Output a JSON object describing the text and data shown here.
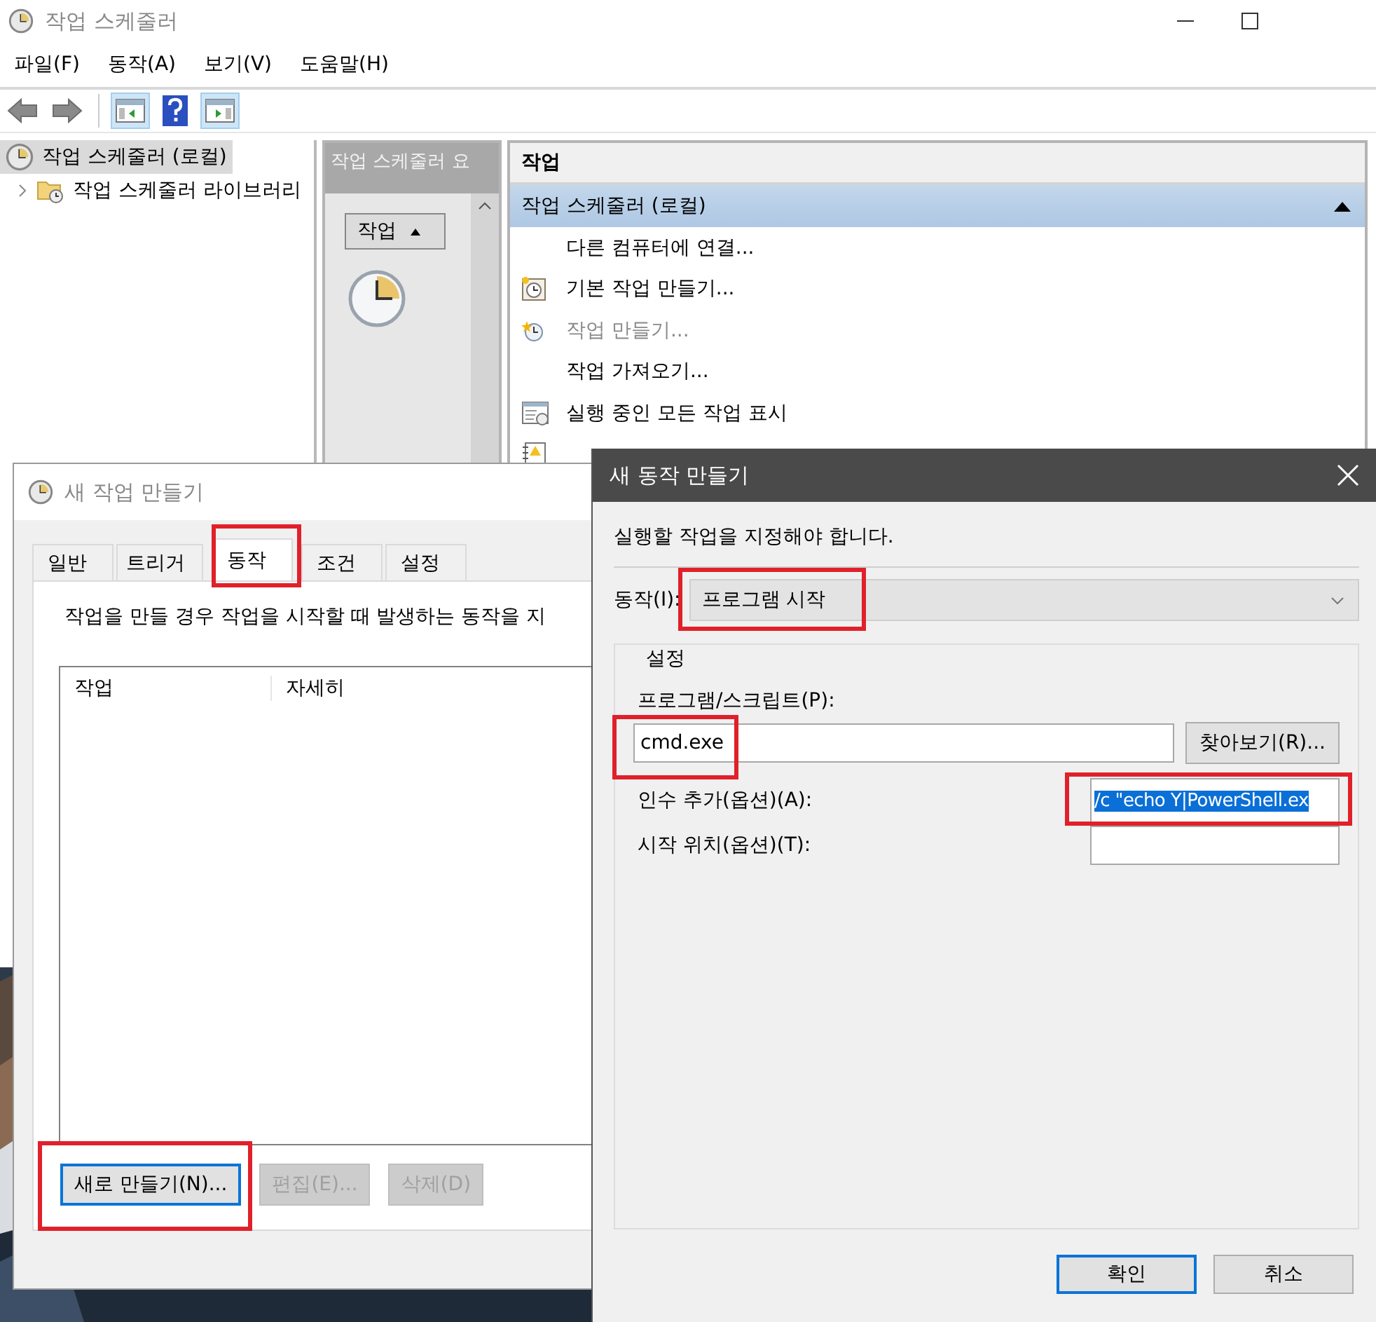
{
  "main_window": {
    "title": "작업 스케줄러"
  },
  "menu": [
    "파일(F)",
    "동작(A)",
    "보기(V)",
    "도움말(H)"
  ],
  "toolbar": [
    {
      "kind": "back",
      "on": false
    },
    {
      "kind": "forward",
      "on": false
    },
    {
      "kind": "panel-left",
      "on": true
    },
    {
      "kind": "help",
      "on": false
    },
    {
      "kind": "panel-right",
      "on": true
    }
  ],
  "tree": [
    {
      "label": "작업 스케줄러 (로컬)",
      "selected": true,
      "children": [
        {
          "label": "작업 스케줄러 라이브러리",
          "selected": false,
          "expanded": false
        }
      ]
    }
  ],
  "summary_pane": {
    "title": "작업 스케줄러 요",
    "column_header": "작업"
  },
  "actions_pane": {
    "title": "작업",
    "group": {
      "label": "작업 스케줄러 (로컬)",
      "expanded": true
    },
    "items": [
      {
        "label": "다른 컴퓨터에 연결...",
        "kind": "plain",
        "disabled": false
      },
      {
        "label": "기본 작업 만들기...",
        "kind": "calendar-clock",
        "disabled": false
      },
      {
        "label": "작업 만들기...",
        "kind": "clock-star",
        "disabled": true
      },
      {
        "label": "작업 가져오기...",
        "kind": "plain",
        "disabled": false
      },
      {
        "label": "실행 중인 모든 작업 표시",
        "kind": "window-list",
        "disabled": false
      },
      {
        "kind": "notebook"
      }
    ]
  },
  "create_task_dialog": {
    "title": "새 작업 만들기",
    "tabs": [
      {
        "label": "일반",
        "selected": false,
        "highlighted": false
      },
      {
        "label": "트리거",
        "selected": false,
        "highlighted": false
      },
      {
        "label": "동작",
        "selected": true,
        "highlighted": true
      },
      {
        "label": "조건",
        "selected": false,
        "highlighted": false
      },
      {
        "label": "설정",
        "selected": false,
        "highlighted": false
      }
    ],
    "description": "작업을 만들 경우 작업을 시작할 때 발생하는 동작을 지",
    "columns": [
      "작업",
      "자세히"
    ],
    "buttons": [
      {
        "label": "새로 만들기(N)...",
        "disabled": false,
        "focused": true,
        "highlighted": true
      },
      {
        "label": "편집(E)...",
        "disabled": true,
        "focused": false,
        "highlighted": false
      },
      {
        "label": "삭제(D)",
        "disabled": true,
        "focused": false,
        "highlighted": false
      }
    ]
  },
  "action_dialog": {
    "title": "새 동작 만들기",
    "instruction": "실행할 작업을 지정해야 합니다.",
    "action": {
      "label": "동작(I):",
      "value": "프로그램 시작",
      "highlighted": true
    },
    "group_title": "설정",
    "program": {
      "label": "프로그램/스크립트(P):",
      "value": "cmd.exe",
      "highlighted": true
    },
    "browse_button": "찾아보기(R)...",
    "arguments": {
      "label": "인수 추가(옵션)(A):",
      "value": "/c \"echo Y|PowerShell.ex",
      "highlighted": true,
      "text_selected": true
    },
    "start_in": {
      "label": "시작 위치(옵션)(T):"
    },
    "buttons": [
      {
        "label": "확인",
        "focused": true
      },
      {
        "label": "취소",
        "focused": false
      }
    ]
  }
}
